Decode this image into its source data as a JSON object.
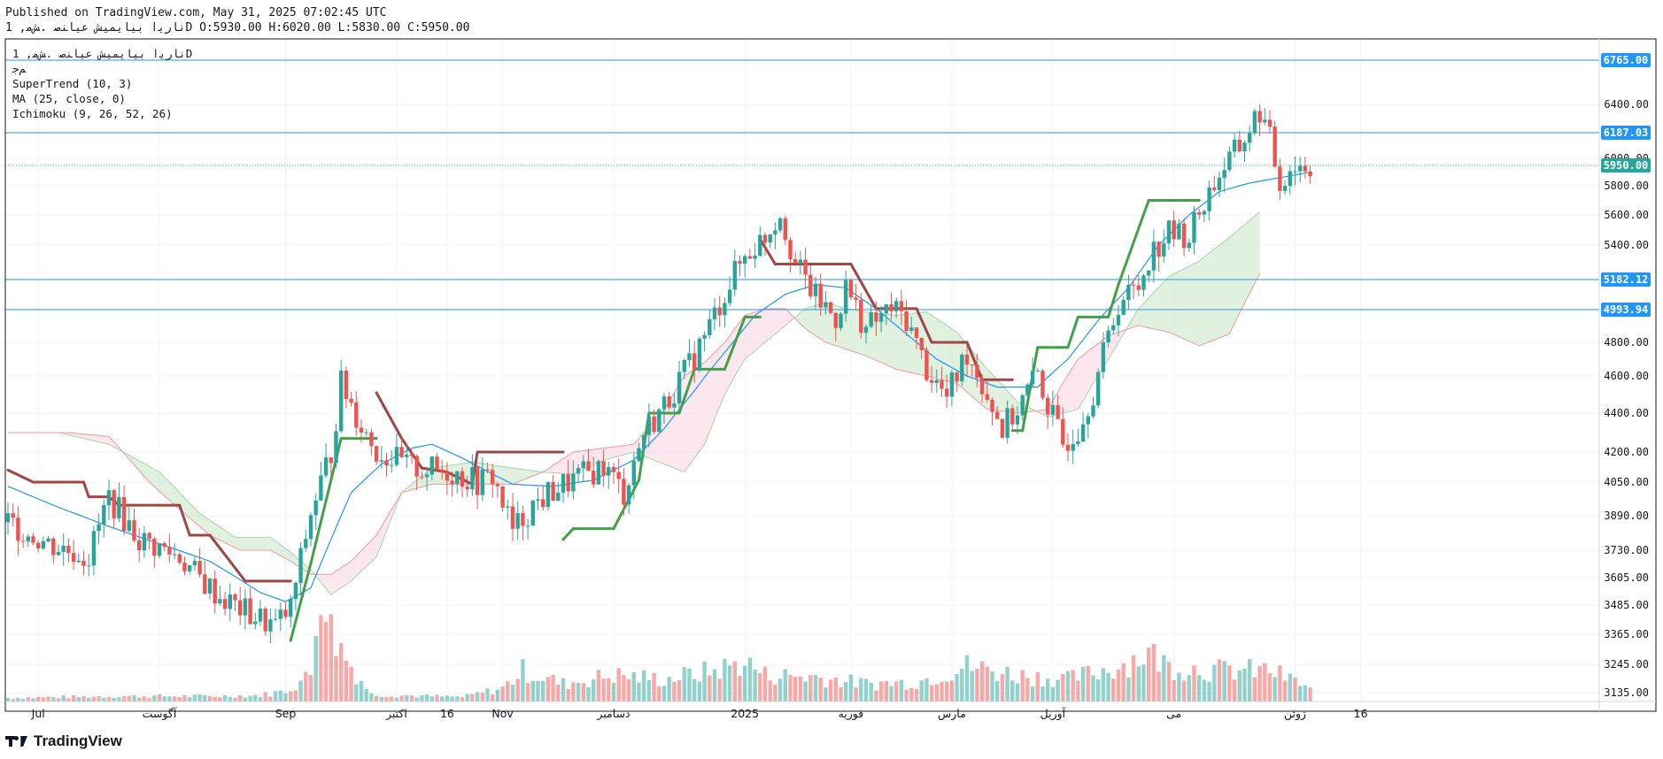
{
  "header": {
    "published": "Published on TradingView.com, May 31, 2025 07:02:45 UTC",
    "ohlc_line": "نارﯾا بیایمیش عیاﻨﺻ .ﺶﻣ, 1D O:5930.00 H:6020.00 L:5830.00 C:5950.00"
  },
  "legend": {
    "symbol": "نارﯾا بیایمیش عیاﻨﺻ .ﺶﻣ, 1D",
    "sub": "ﻢﺟ",
    "indicators": [
      "SuperTrend (10, 3)",
      "MA (25, close, 0)",
      "Ichimoku (9, 26, 52, 26)"
    ]
  },
  "footer": {
    "brand": "TradingView"
  },
  "colors": {
    "up": "#26a69a",
    "down": "#ef5350",
    "st_up": "#43a047",
    "st_down": "#a04646",
    "ma": "#2196f3",
    "level": "#2196f3",
    "last": "#26a69a"
  },
  "chart_data": {
    "type": "candlestick",
    "y_ticks": [
      6400,
      6000,
      5800,
      5600,
      5400,
      4800,
      4600,
      4400,
      4200,
      4050,
      3890,
      3730,
      3605,
      3485,
      3365,
      3245,
      3135
    ],
    "x_labels": [
      {
        "label": "Jul",
        "day": 6
      },
      {
        "label": "آگوست",
        "day": 30
      },
      {
        "label": "Sep",
        "day": 55
      },
      {
        "label": "اکتبر",
        "day": 77
      },
      {
        "label": "16",
        "day": 87
      },
      {
        "label": "Nov",
        "day": 98
      },
      {
        "label": "دسامبر",
        "day": 120
      },
      {
        "label": "2025",
        "day": 146
      },
      {
        "label": "فوریه",
        "day": 167
      },
      {
        "label": "مارس",
        "day": 187
      },
      {
        "label": "آوریل",
        "day": 207
      },
      {
        "label": "می",
        "day": 231
      },
      {
        "label": "ژوئن",
        "day": 255
      },
      {
        "label": "16",
        "day": 268
      }
    ],
    "levels": [
      {
        "label": "6765.00",
        "value": 6765
      },
      {
        "label": "6187.03",
        "value": 6187
      },
      {
        "label": "5182.12",
        "value": 5182
      },
      {
        "label": "4993.94",
        "value": 4994
      }
    ],
    "last_price": {
      "label": "5950.00",
      "value": 5950
    },
    "keypoints_close": [
      [
        0,
        3860
      ],
      [
        8,
        3760
      ],
      [
        16,
        3700
      ],
      [
        20,
        3980
      ],
      [
        26,
        3780
      ],
      [
        34,
        3700
      ],
      [
        38,
        3600
      ],
      [
        42,
        3520
      ],
      [
        48,
        3445
      ],
      [
        53,
        3400
      ],
      [
        56,
        3470
      ],
      [
        60,
        3900
      ],
      [
        64,
        4200
      ],
      [
        66,
        4560
      ],
      [
        70,
        4340
      ],
      [
        73,
        4205
      ],
      [
        80,
        4120
      ],
      [
        88,
        4100
      ],
      [
        93,
        4050
      ],
      [
        96,
        4080
      ],
      [
        100,
        3820
      ],
      [
        104,
        3940
      ],
      [
        108,
        4010
      ],
      [
        112,
        4060
      ],
      [
        118,
        4130
      ],
      [
        122,
        4000
      ],
      [
        126,
        4300
      ],
      [
        130,
        4440
      ],
      [
        134,
        4620
      ],
      [
        136,
        4720
      ],
      [
        140,
        4960
      ],
      [
        142,
        5100
      ],
      [
        144,
        5220
      ],
      [
        146,
        5330
      ],
      [
        150,
        5460
      ],
      [
        153,
        5620
      ],
      [
        156,
        5280
      ],
      [
        160,
        5070
      ],
      [
        164,
        4940
      ],
      [
        166,
        5130
      ],
      [
        170,
        4880
      ],
      [
        175,
        5000
      ],
      [
        178,
        4940
      ],
      [
        182,
        4640
      ],
      [
        186,
        4480
      ],
      [
        190,
        4740
      ],
      [
        194,
        4500
      ],
      [
        197,
        4320
      ],
      [
        200,
        4420
      ],
      [
        204,
        4620
      ],
      [
        206,
        4440
      ],
      [
        209,
        4240
      ],
      [
        212,
        4330
      ],
      [
        215,
        4520
      ],
      [
        220,
        5040
      ],
      [
        224,
        5140
      ],
      [
        226,
        5330
      ],
      [
        230,
        5480
      ],
      [
        234,
        5460
      ],
      [
        236,
        5620
      ],
      [
        240,
        5890
      ],
      [
        244,
        6080
      ],
      [
        248,
        6350
      ],
      [
        250,
        6130
      ],
      [
        252,
        5810
      ],
      [
        254,
        5940
      ],
      [
        258,
        5950
      ]
    ],
    "volume_keypoints": [
      [
        0,
        4
      ],
      [
        10,
        5
      ],
      [
        20,
        6
      ],
      [
        30,
        6
      ],
      [
        40,
        6
      ],
      [
        50,
        7
      ],
      [
        55,
        12
      ],
      [
        60,
        30
      ],
      [
        62,
        150
      ],
      [
        64,
        80
      ],
      [
        68,
        40
      ],
      [
        72,
        8
      ],
      [
        90,
        5
      ],
      [
        98,
        15
      ],
      [
        102,
        35
      ],
      [
        110,
        20
      ],
      [
        120,
        30
      ],
      [
        130,
        25
      ],
      [
        140,
        35
      ],
      [
        146,
        45
      ],
      [
        150,
        30
      ],
      [
        160,
        28
      ],
      [
        170,
        20
      ],
      [
        180,
        22
      ],
      [
        190,
        40
      ],
      [
        200,
        30
      ],
      [
        210,
        25
      ],
      [
        220,
        40
      ],
      [
        226,
        55
      ],
      [
        230,
        40
      ],
      [
        240,
        35
      ],
      [
        250,
        35
      ],
      [
        256,
        20
      ],
      [
        258,
        15
      ]
    ],
    "supertrend": [
      [
        0,
        4110,
        "down"
      ],
      [
        5,
        4050,
        "down"
      ],
      [
        15,
        4050,
        "down"
      ],
      [
        16,
        3980,
        "down"
      ],
      [
        20,
        3980,
        "down"
      ],
      [
        22,
        3940,
        "down"
      ],
      [
        34,
        3940,
        "down"
      ],
      [
        36,
        3800,
        "down"
      ],
      [
        40,
        3800,
        "down"
      ],
      [
        47,
        3590,
        "down"
      ],
      [
        56,
        3590,
        "down"
      ],
      [
        56,
        3340,
        "up"
      ],
      [
        60,
        3670,
        "up"
      ],
      [
        66,
        4270,
        "up"
      ],
      [
        73,
        4270,
        "up"
      ],
      [
        73,
        4510,
        "down"
      ],
      [
        78,
        4270,
        "down"
      ],
      [
        82,
        4120,
        "down"
      ],
      [
        87,
        4100,
        "down"
      ],
      [
        92,
        4040,
        "down"
      ],
      [
        93,
        4200,
        "down"
      ],
      [
        110,
        4200,
        "down"
      ],
      [
        110,
        3780,
        "up"
      ],
      [
        112,
        3830,
        "up"
      ],
      [
        120,
        3830,
        "up"
      ],
      [
        125,
        4060,
        "up"
      ],
      [
        127,
        4400,
        "up"
      ],
      [
        133,
        4400,
        "up"
      ],
      [
        136,
        4640,
        "up"
      ],
      [
        142,
        4640,
        "up"
      ],
      [
        146,
        4950,
        "up"
      ],
      [
        149,
        4950,
        "up"
      ],
      [
        149,
        5440,
        "down"
      ],
      [
        152,
        5280,
        "down"
      ],
      [
        167,
        5280,
        "down"
      ],
      [
        172,
        5000,
        "down"
      ],
      [
        180,
        5000,
        "down"
      ],
      [
        183,
        4800,
        "down"
      ],
      [
        190,
        4800,
        "down"
      ],
      [
        193,
        4580,
        "down"
      ],
      [
        199,
        4580,
        "down"
      ],
      [
        199,
        4310,
        "up"
      ],
      [
        201,
        4310,
        "up"
      ],
      [
        204,
        4770,
        "up"
      ],
      [
        210,
        4770,
        "up"
      ],
      [
        212,
        4950,
        "up"
      ],
      [
        218,
        4950,
        "up"
      ],
      [
        220,
        5150,
        "up"
      ],
      [
        226,
        5700,
        "up"
      ],
      [
        232,
        5700,
        "up"
      ],
      [
        236,
        5700,
        "up"
      ]
    ],
    "ma25": [
      [
        0,
        4030
      ],
      [
        10,
        3930
      ],
      [
        20,
        3840
      ],
      [
        30,
        3760
      ],
      [
        40,
        3680
      ],
      [
        50,
        3540
      ],
      [
        55,
        3500
      ],
      [
        60,
        3560
      ],
      [
        64,
        3780
      ],
      [
        68,
        4000
      ],
      [
        74,
        4140
      ],
      [
        80,
        4220
      ],
      [
        84,
        4240
      ],
      [
        90,
        4170
      ],
      [
        96,
        4090
      ],
      [
        100,
        4040
      ],
      [
        108,
        4030
      ],
      [
        116,
        4060
      ],
      [
        124,
        4160
      ],
      [
        130,
        4320
      ],
      [
        136,
        4520
      ],
      [
        142,
        4740
      ],
      [
        148,
        4960
      ],
      [
        154,
        5090
      ],
      [
        160,
        5150
      ],
      [
        166,
        5130
      ],
      [
        172,
        5000
      ],
      [
        178,
        4850
      ],
      [
        184,
        4700
      ],
      [
        190,
        4600
      ],
      [
        196,
        4540
      ],
      [
        204,
        4540
      ],
      [
        210,
        4700
      ],
      [
        216,
        4930
      ],
      [
        222,
        5130
      ],
      [
        228,
        5400
      ],
      [
        234,
        5600
      ],
      [
        240,
        5760
      ],
      [
        246,
        5820
      ],
      [
        252,
        5860
      ],
      [
        258,
        5900
      ]
    ],
    "cloud_a": [
      [
        0,
        4300
      ],
      [
        10,
        4300
      ],
      [
        20,
        4240
      ],
      [
        30,
        4100
      ],
      [
        38,
        3900
      ],
      [
        45,
        3790
      ],
      [
        52,
        3790
      ],
      [
        56,
        3720
      ],
      [
        60,
        3640
      ],
      [
        64,
        3530
      ],
      [
        68,
        3590
      ],
      [
        73,
        3700
      ],
      [
        78,
        4000
      ],
      [
        84,
        4120
      ],
      [
        92,
        4150
      ],
      [
        100,
        4120
      ],
      [
        106,
        4100
      ],
      [
        112,
        4090
      ],
      [
        118,
        4160
      ],
      [
        124,
        4200
      ],
      [
        130,
        4140
      ],
      [
        134,
        4100
      ],
      [
        138,
        4240
      ],
      [
        142,
        4500
      ],
      [
        146,
        4700
      ],
      [
        150,
        4800
      ],
      [
        154,
        4900
      ],
      [
        158,
        5000
      ],
      [
        162,
        5040
      ],
      [
        166,
        5000
      ],
      [
        170,
        4980
      ],
      [
        176,
        4960
      ],
      [
        182,
        4980
      ],
      [
        188,
        4860
      ],
      [
        194,
        4640
      ],
      [
        200,
        4460
      ],
      [
        206,
        4380
      ],
      [
        212,
        4420
      ],
      [
        218,
        4700
      ],
      [
        224,
        5000
      ],
      [
        230,
        5200
      ],
      [
        236,
        5300
      ],
      [
        242,
        5450
      ],
      [
        248,
        5620
      ]
    ],
    "cloud_b": [
      [
        0,
        4300
      ],
      [
        12,
        4300
      ],
      [
        20,
        4280
      ],
      [
        28,
        4050
      ],
      [
        34,
        3920
      ],
      [
        40,
        3800
      ],
      [
        46,
        3730
      ],
      [
        52,
        3730
      ],
      [
        56,
        3680
      ],
      [
        60,
        3620
      ],
      [
        64,
        3620
      ],
      [
        68,
        3680
      ],
      [
        73,
        3800
      ],
      [
        78,
        4000
      ],
      [
        84,
        4040
      ],
      [
        92,
        4040
      ],
      [
        100,
        4040
      ],
      [
        106,
        4100
      ],
      [
        112,
        4200
      ],
      [
        118,
        4220
      ],
      [
        124,
        4240
      ],
      [
        130,
        4420
      ],
      [
        134,
        4600
      ],
      [
        138,
        4680
      ],
      [
        142,
        4800
      ],
      [
        146,
        4960
      ],
      [
        150,
        5000
      ],
      [
        154,
        5000
      ],
      [
        158,
        4880
      ],
      [
        162,
        4800
      ],
      [
        166,
        4760
      ],
      [
        170,
        4720
      ],
      [
        176,
        4640
      ],
      [
        182,
        4600
      ],
      [
        188,
        4560
      ],
      [
        194,
        4420
      ],
      [
        200,
        4400
      ],
      [
        206,
        4420
      ],
      [
        212,
        4700
      ],
      [
        218,
        4840
      ],
      [
        224,
        4900
      ],
      [
        230,
        4860
      ],
      [
        236,
        4780
      ],
      [
        242,
        4850
      ],
      [
        248,
        5220
      ]
    ]
  }
}
